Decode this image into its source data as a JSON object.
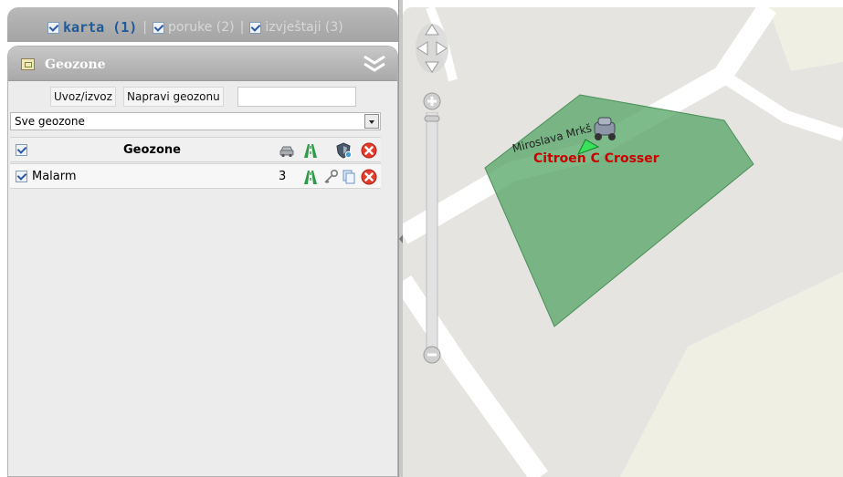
{
  "tabs": [
    {
      "label": "karta (1)",
      "active": true
    },
    {
      "label": "poruke (2)",
      "active": false
    },
    {
      "label": "izvještaji (3)",
      "active": false
    }
  ],
  "tab_separator": "|",
  "panel": {
    "title": "Geozone",
    "toolbar": {
      "import_export": "Uvoz/izvoz",
      "new_geozone": "Napravi geozonu",
      "search_value": ""
    },
    "filter_selected": "Sve geozone",
    "list_header": {
      "label": "Geozone",
      "icons": [
        "car-icon",
        "road-icon",
        "shield-icon",
        "delete-icon"
      ]
    },
    "rows": [
      {
        "name": "Malarm",
        "count": "3",
        "icons": [
          "road-icon",
          "key-icon",
          "copy-icon",
          "delete-icon"
        ]
      }
    ]
  },
  "map": {
    "street_label": "Miroslava Mrkš",
    "vehicle_label": "Citroen C Crosser",
    "colors": {
      "geozone_fill": "#6fb27a",
      "vehicle_label": "#cc0000",
      "road": "#ffffff",
      "land": "#e6e4e0"
    }
  }
}
